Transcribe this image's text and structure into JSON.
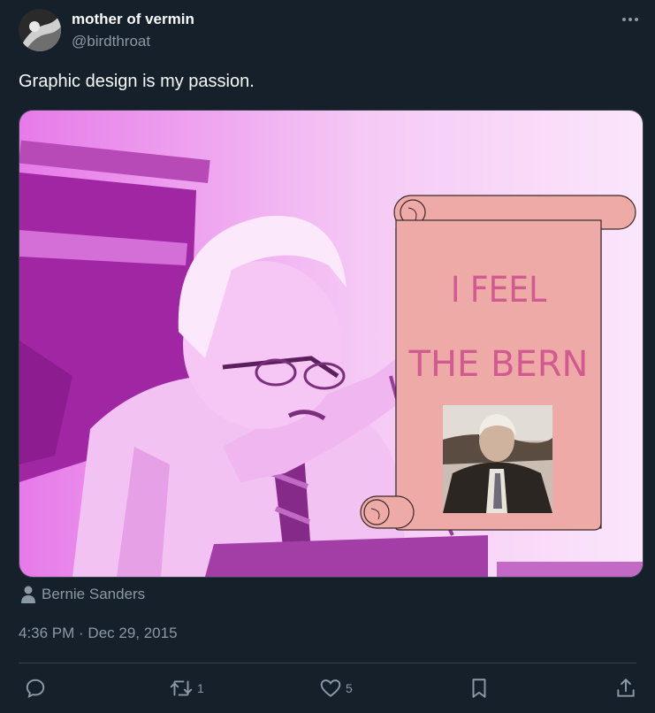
{
  "author": {
    "display_name": "mother of vermin",
    "handle": "@birdthroat"
  },
  "tweet": {
    "text": "Graphic design is my passion."
  },
  "media": {
    "poster_line1": "I FEEL",
    "poster_line2": "THE BERN",
    "tint_color": "#e040e8",
    "scroll_color": "#eeaaa6"
  },
  "tag": {
    "label": "Bernie Sanders"
  },
  "meta": {
    "timestamp": "4:36 PM · Dec 29, 2015"
  },
  "actions": {
    "reply_count": "",
    "retweet_count": "1",
    "like_count": "5"
  },
  "colors": {
    "background": "#15202b",
    "secondary_text": "#8b98a5",
    "border": "#38444d"
  }
}
